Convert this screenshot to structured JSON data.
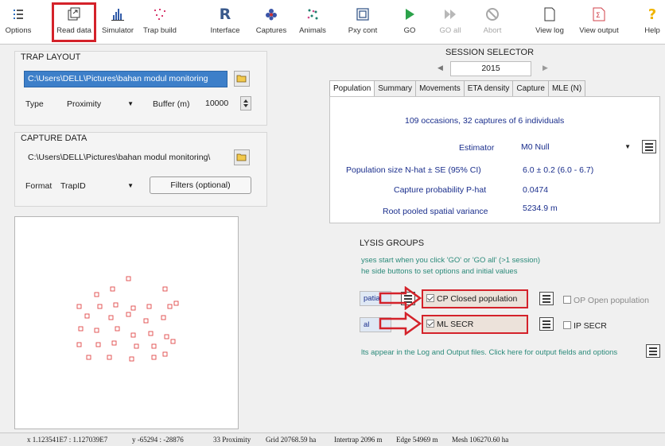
{
  "toolbar": {
    "buttons": [
      {
        "label": "Options",
        "icon": "options-icon"
      },
      {
        "label": "Read data",
        "icon": "read-data-icon"
      },
      {
        "label": "Simulator",
        "icon": "simulator-icon"
      },
      {
        "label": "Trap build",
        "icon": "trap-build-icon"
      },
      {
        "label": "Interface",
        "icon": "interface-icon"
      },
      {
        "label": "Captures",
        "icon": "captures-icon"
      },
      {
        "label": "Animals",
        "icon": "animals-icon"
      },
      {
        "label": "Pxy cont",
        "icon": "pxy-cont-icon"
      },
      {
        "label": "GO",
        "icon": "go-icon"
      },
      {
        "label": "GO all",
        "icon": "go-all-icon"
      },
      {
        "label": "Abort",
        "icon": "abort-icon"
      },
      {
        "label": "View log",
        "icon": "view-log-icon"
      },
      {
        "label": "View output",
        "icon": "view-output-icon"
      },
      {
        "label": "Help",
        "icon": "help-icon"
      }
    ]
  },
  "trap_layout": {
    "title": "TRAP LAYOUT",
    "file": "C:\\Users\\DELL\\Pictures\\bahan modul monitoring",
    "type_label": "Type",
    "type_value": "Proximity",
    "buffer_label": "Buffer (m)",
    "buffer_value": "10000"
  },
  "capture_data": {
    "title": "CAPTURE DATA",
    "file": "C:\\Users\\DELL\\Pictures\\bahan modul monitoring\\",
    "format_label": "Format",
    "format_value": "TrapID",
    "filters_label": "Filters (optional)"
  },
  "session": {
    "title": "SESSION SELECTOR",
    "value": "2015"
  },
  "tabs": [
    "Population",
    "Summary",
    "Movements",
    "ETA density",
    "Capture",
    "MLE (N)"
  ],
  "results": {
    "summary": "109 occasions, 32 captures of 6 individuals",
    "estimator_label": "Estimator",
    "estimator_value": "M0 Null",
    "popsize_label": "Population size  N-hat ± SE (95% CI)",
    "popsize_value": "6.0 ± 0.2 (6.0 - 6.7)",
    "capprob_label": "Capture probability  P-hat",
    "capprob_value": "0.0474",
    "variance_label": "Root pooled spatial variance",
    "variance_value": "5234.9 m"
  },
  "analysis": {
    "title": "LYSIS GROUPS",
    "hint1": "yses start when you click 'GO' or 'GO all' (>1 session)",
    "hint2": "he side buttons to set options and initial values",
    "row1_left": "patial",
    "row1_check": "CP  Closed population",
    "row1_right": "OP  Open population",
    "row2_left": "al",
    "row2_check": "ML  SECR",
    "row2_right": "IP  SECR",
    "footer": "lts appear in the Log and Output files. Click here for output fields and options"
  },
  "status": {
    "xrange": "x  1.123541E7 : 1.127039E7",
    "yrange": "y  -65294 : -28876",
    "detectors": "33  Proximity",
    "grid": "Grid  20768.59 ha",
    "intertrap": "Intertrap  2096 m",
    "edge": "Edge  54969 m",
    "mesh": "Mesh  106270.60 ha"
  },
  "colors": {
    "highlight": "#d4222a",
    "selection": "#3d7fc9",
    "trap_marker": "#e04848",
    "result_text": "#1a2e8c",
    "hint_text": "#2b8a7a"
  }
}
